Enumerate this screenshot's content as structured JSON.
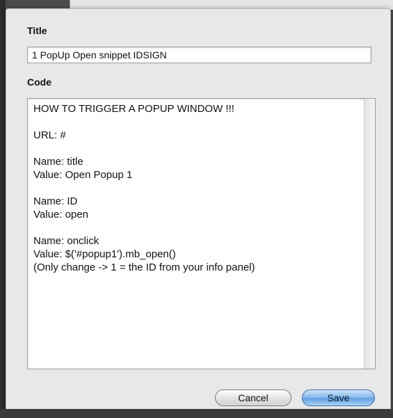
{
  "dialog": {
    "title_label": "Title",
    "title_value": "1 PopUp Open snippet IDSIGN",
    "code_label": "Code",
    "code_value": "HOW TO TRIGGER A POPUP WINDOW !!!\n\nURL: #\n\nName: title\nValue: Open Popup 1\n\nName: ID\nValue: open\n\nName: onclick\nValue: $('#popup1').mb_open()\n(Only change -> 1 = the ID from your info panel)",
    "cancel_label": "Cancel",
    "save_label": "Save"
  },
  "colors": {
    "sheet_background": "#e8e8e8",
    "default_button": "#7fb6ea"
  }
}
